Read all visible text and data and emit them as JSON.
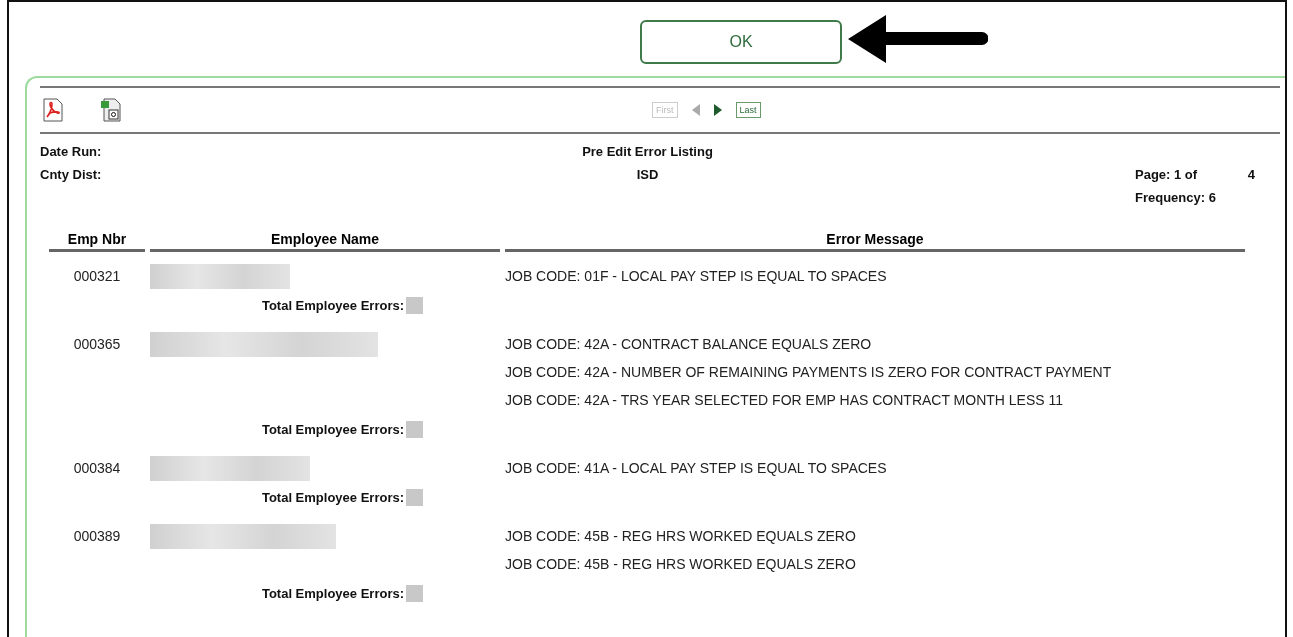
{
  "ok_button": {
    "label": "OK"
  },
  "toolbar": {
    "pager": [
      {
        "kind": "first",
        "label": "First",
        "disabled": true
      },
      {
        "kind": "prev",
        "disabled": true
      },
      {
        "kind": "next",
        "disabled": false
      },
      {
        "kind": "last",
        "label": "Last",
        "disabled": false
      }
    ]
  },
  "report": {
    "date_run_label": "Date Run:",
    "cnty_dist_label": "Cnty Dist:",
    "title": "Pre Edit Error Listing",
    "district": "ISD",
    "page_label": "Page: 1 of",
    "page_total": "4",
    "frequency": "Frequency: 6"
  },
  "table": {
    "columns": [
      "Emp Nbr",
      "Employee Name",
      "Error Message"
    ],
    "rows": [
      {
        "emp_nbr": "000321",
        "errors": [
          "JOB CODE: 01F - LOCAL PAY STEP IS EQUAL TO SPACES"
        ],
        "total_label": "Total Employee Errors:"
      },
      {
        "emp_nbr": "000365",
        "errors": [
          "JOB CODE: 42A - CONTRACT BALANCE EQUALS ZERO",
          "JOB CODE: 42A - NUMBER OF REMAINING PAYMENTS IS ZERO FOR CONTRACT PAYMENT",
          "JOB CODE: 42A - TRS YEAR SELECTED FOR EMP HAS CONTRACT MONTH LESS 11"
        ],
        "total_label": "Total Employee Errors:"
      },
      {
        "emp_nbr": "000384",
        "errors": [
          "JOB CODE: 41A - LOCAL PAY STEP IS EQUAL TO SPACES"
        ],
        "total_label": "Total Employee Errors:"
      },
      {
        "emp_nbr": "000389",
        "errors": [
          "JOB CODE: 45B - REG HRS WORKED EQUALS ZERO",
          "JOB CODE: 45B - REG HRS WORKED EQUALS ZERO"
        ],
        "total_label": "Total Employee Errors:"
      }
    ]
  }
}
